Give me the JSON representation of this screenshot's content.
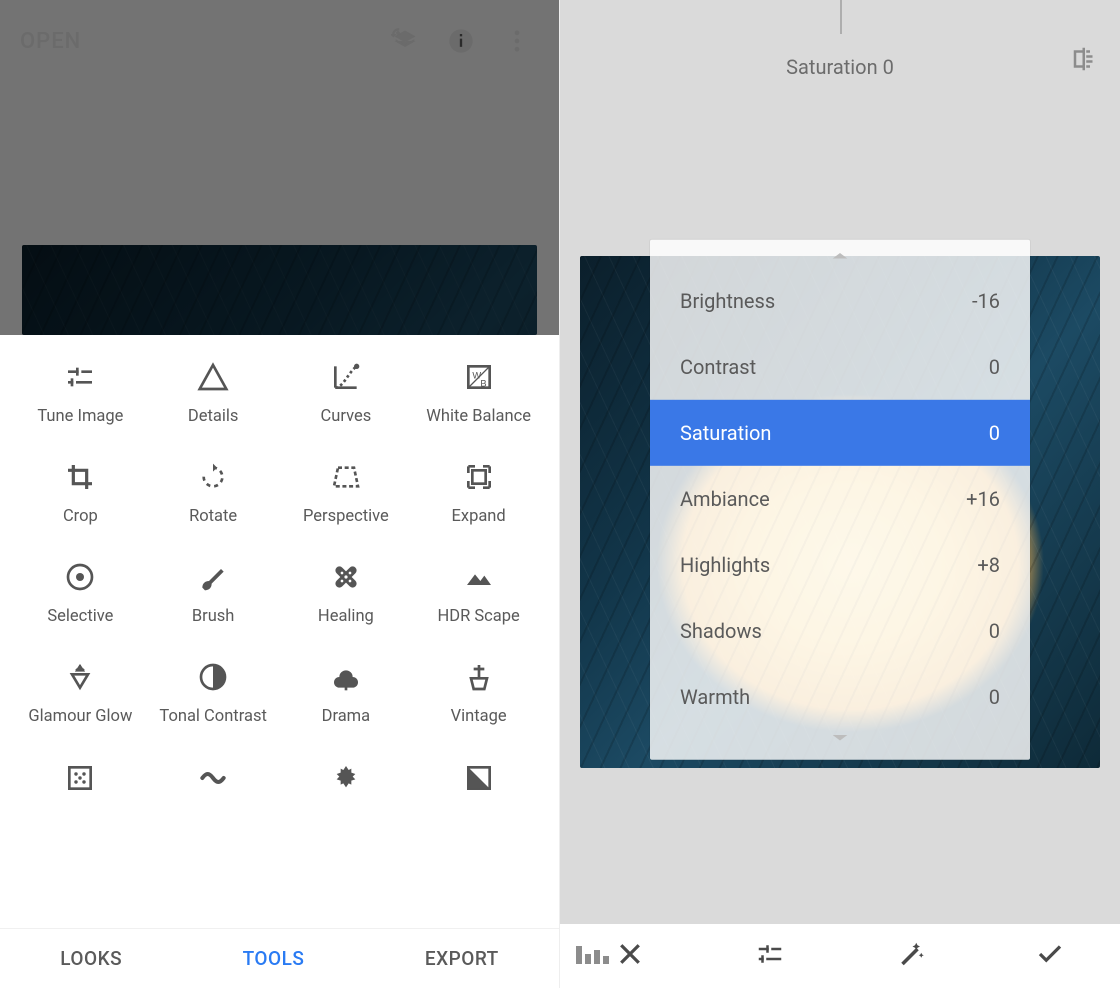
{
  "left": {
    "open_label": "OPEN",
    "header_icons": [
      "layers-undo-icon",
      "info-icon",
      "more-vert-icon"
    ],
    "tools": [
      {
        "name": "tune-image",
        "label": "Tune Image"
      },
      {
        "name": "details",
        "label": "Details"
      },
      {
        "name": "curves",
        "label": "Curves"
      },
      {
        "name": "white-balance",
        "label": "White Balance"
      },
      {
        "name": "crop",
        "label": "Crop"
      },
      {
        "name": "rotate",
        "label": "Rotate"
      },
      {
        "name": "perspective",
        "label": "Perspective"
      },
      {
        "name": "expand",
        "label": "Expand"
      },
      {
        "name": "selective",
        "label": "Selective"
      },
      {
        "name": "brush",
        "label": "Brush"
      },
      {
        "name": "healing",
        "label": "Healing"
      },
      {
        "name": "hdr-scape",
        "label": "HDR Scape"
      },
      {
        "name": "glamour-glow",
        "label": "Glamour Glow"
      },
      {
        "name": "tonal-contrast",
        "label": "Tonal Contrast"
      },
      {
        "name": "drama",
        "label": "Drama"
      },
      {
        "name": "vintage",
        "label": "Vintage"
      },
      {
        "name": "grainy-film",
        "label": ""
      },
      {
        "name": "retrolux",
        "label": ""
      },
      {
        "name": "grunge",
        "label": ""
      },
      {
        "name": "bw",
        "label": ""
      }
    ],
    "tabs": {
      "looks": "LOOKS",
      "tools": "TOOLS",
      "export": "EXPORT",
      "active": "tools"
    }
  },
  "right": {
    "header_title": "Saturation 0",
    "adjustments": [
      {
        "name": "Brightness",
        "value": "-16",
        "selected": false
      },
      {
        "name": "Contrast",
        "value": "0",
        "selected": false
      },
      {
        "name": "Saturation",
        "value": "0",
        "selected": true
      },
      {
        "name": "Ambiance",
        "value": "+16",
        "selected": false
      },
      {
        "name": "Highlights",
        "value": "+8",
        "selected": false
      },
      {
        "name": "Shadows",
        "value": "0",
        "selected": false
      },
      {
        "name": "Warmth",
        "value": "0",
        "selected": false
      }
    ],
    "bottom_icons": [
      "close-icon",
      "tune-sliders-icon",
      "magic-wand-icon",
      "check-icon"
    ]
  },
  "colors": {
    "accent": "#3a78e7",
    "tab_active": "#2a7bf3"
  }
}
